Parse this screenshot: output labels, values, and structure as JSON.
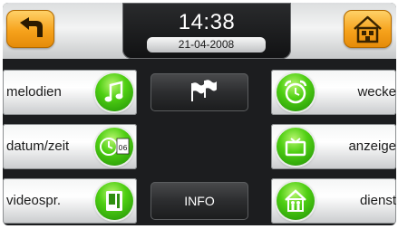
{
  "header": {
    "time": "14:38",
    "date": "21-04-2008",
    "back_icon": "back-arrow-icon",
    "home_icon": "home-icon"
  },
  "menu": {
    "left": [
      {
        "label": "melodien",
        "icon": "music-note-icon"
      },
      {
        "label": "datum/zeit",
        "icon": "clock-calendar-icon"
      },
      {
        "label": "videospr.",
        "icon": "video-intercom-icon"
      }
    ],
    "right": [
      {
        "label": "wecke",
        "icon": "alarm-clock-icon"
      },
      {
        "label": "anzeige",
        "icon": "display-icon"
      },
      {
        "label": "dienst",
        "icon": "service-icon"
      }
    ],
    "center": {
      "language_icon": "flags-icon",
      "info_label": "INFO"
    }
  },
  "colors": {
    "accent_orange": "#f6a21c",
    "accent_green": "#4fcf13",
    "background_dark": "#1c1d1f"
  }
}
